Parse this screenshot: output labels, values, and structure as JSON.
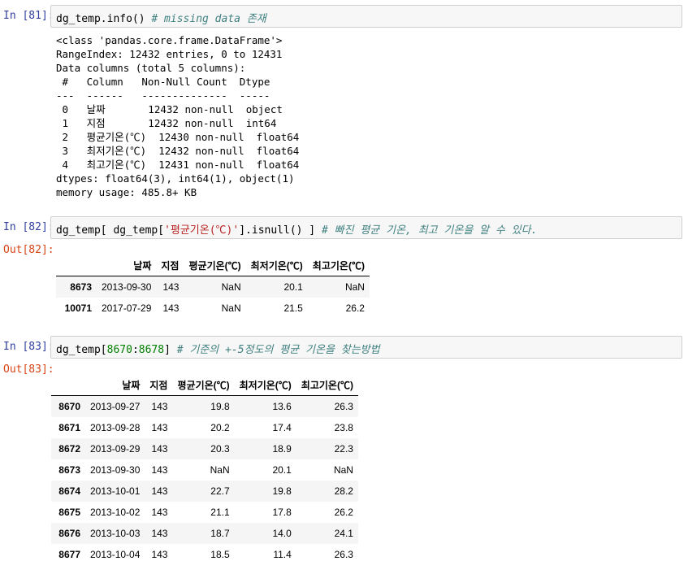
{
  "cells": [
    {
      "prompt": "In [81]:",
      "code_prefix": "dg_temp.info() ",
      "comment": "# missing data 존재",
      "stdout": [
        "<class 'pandas.core.frame.DataFrame'>",
        "RangeIndex: 12432 entries, 0 to 12431",
        "Data columns (total 5 columns):",
        " #   Column   Non-Null Count  Dtype  ",
        "---  ------   --------------  -----  ",
        " 0   날짜       12432 non-null  object ",
        " 1   지점       12432 non-null  int64  ",
        " 2   평균기온(℃)  12430 non-null  float64",
        " 3   최저기온(℃)  12432 non-null  float64",
        " 4   최고기온(℃)  12431 non-null  float64",
        "dtypes: float64(3), int64(1), object(1)",
        "memory usage: 485.8+ KB"
      ]
    },
    {
      "prompt": "In [82]:",
      "code_prefix": "dg_temp[ dg_temp[",
      "code_string": "'평균기온(℃)'",
      "code_suffix": "].isnull() ] ",
      "comment": "# 빠진 평균 기온, 최고 기온을 알 수 있다.",
      "out_prompt": "Out[82]:",
      "table": {
        "columns": [
          "날짜",
          "지점",
          "평균기온(℃)",
          "최저기온(℃)",
          "최고기온(℃)"
        ],
        "rows": [
          {
            "index": "8673",
            "values": [
              "2013-09-30",
              "143",
              "NaN",
              "20.1",
              "NaN"
            ]
          },
          {
            "index": "10071",
            "values": [
              "2017-07-29",
              "143",
              "NaN",
              "21.5",
              "26.2"
            ]
          }
        ]
      }
    },
    {
      "prompt": "In [83]:",
      "code_prefix": "dg_temp[",
      "code_num1": "8670",
      "code_colon": ":",
      "code_num2": "8678",
      "code_suffix": "] ",
      "comment": "# 기준의 +-5정도의 평균 기온을 찾는방법",
      "out_prompt": "Out[83]:",
      "table": {
        "columns": [
          "날짜",
          "지점",
          "평균기온(℃)",
          "최저기온(℃)",
          "최고기온(℃)"
        ],
        "rows": [
          {
            "index": "8670",
            "values": [
              "2013-09-27",
              "143",
              "19.8",
              "13.6",
              "26.3"
            ]
          },
          {
            "index": "8671",
            "values": [
              "2013-09-28",
              "143",
              "20.2",
              "17.4",
              "23.8"
            ]
          },
          {
            "index": "8672",
            "values": [
              "2013-09-29",
              "143",
              "20.3",
              "18.9",
              "22.3"
            ]
          },
          {
            "index": "8673",
            "values": [
              "2013-09-30",
              "143",
              "NaN",
              "20.1",
              "NaN"
            ]
          },
          {
            "index": "8674",
            "values": [
              "2013-10-01",
              "143",
              "22.7",
              "19.8",
              "28.2"
            ]
          },
          {
            "index": "8675",
            "values": [
              "2013-10-02",
              "143",
              "21.1",
              "17.8",
              "26.2"
            ]
          },
          {
            "index": "8676",
            "values": [
              "2013-10-03",
              "143",
              "18.7",
              "14.0",
              "24.1"
            ]
          },
          {
            "index": "8677",
            "values": [
              "2013-10-04",
              "143",
              "18.5",
              "11.4",
              "26.3"
            ]
          }
        ]
      }
    }
  ],
  "colors": {
    "in_prompt": "#303f9f",
    "out_prompt": "#d84315",
    "comment": "#408080",
    "string": "#ba2121",
    "number": "#008000"
  }
}
